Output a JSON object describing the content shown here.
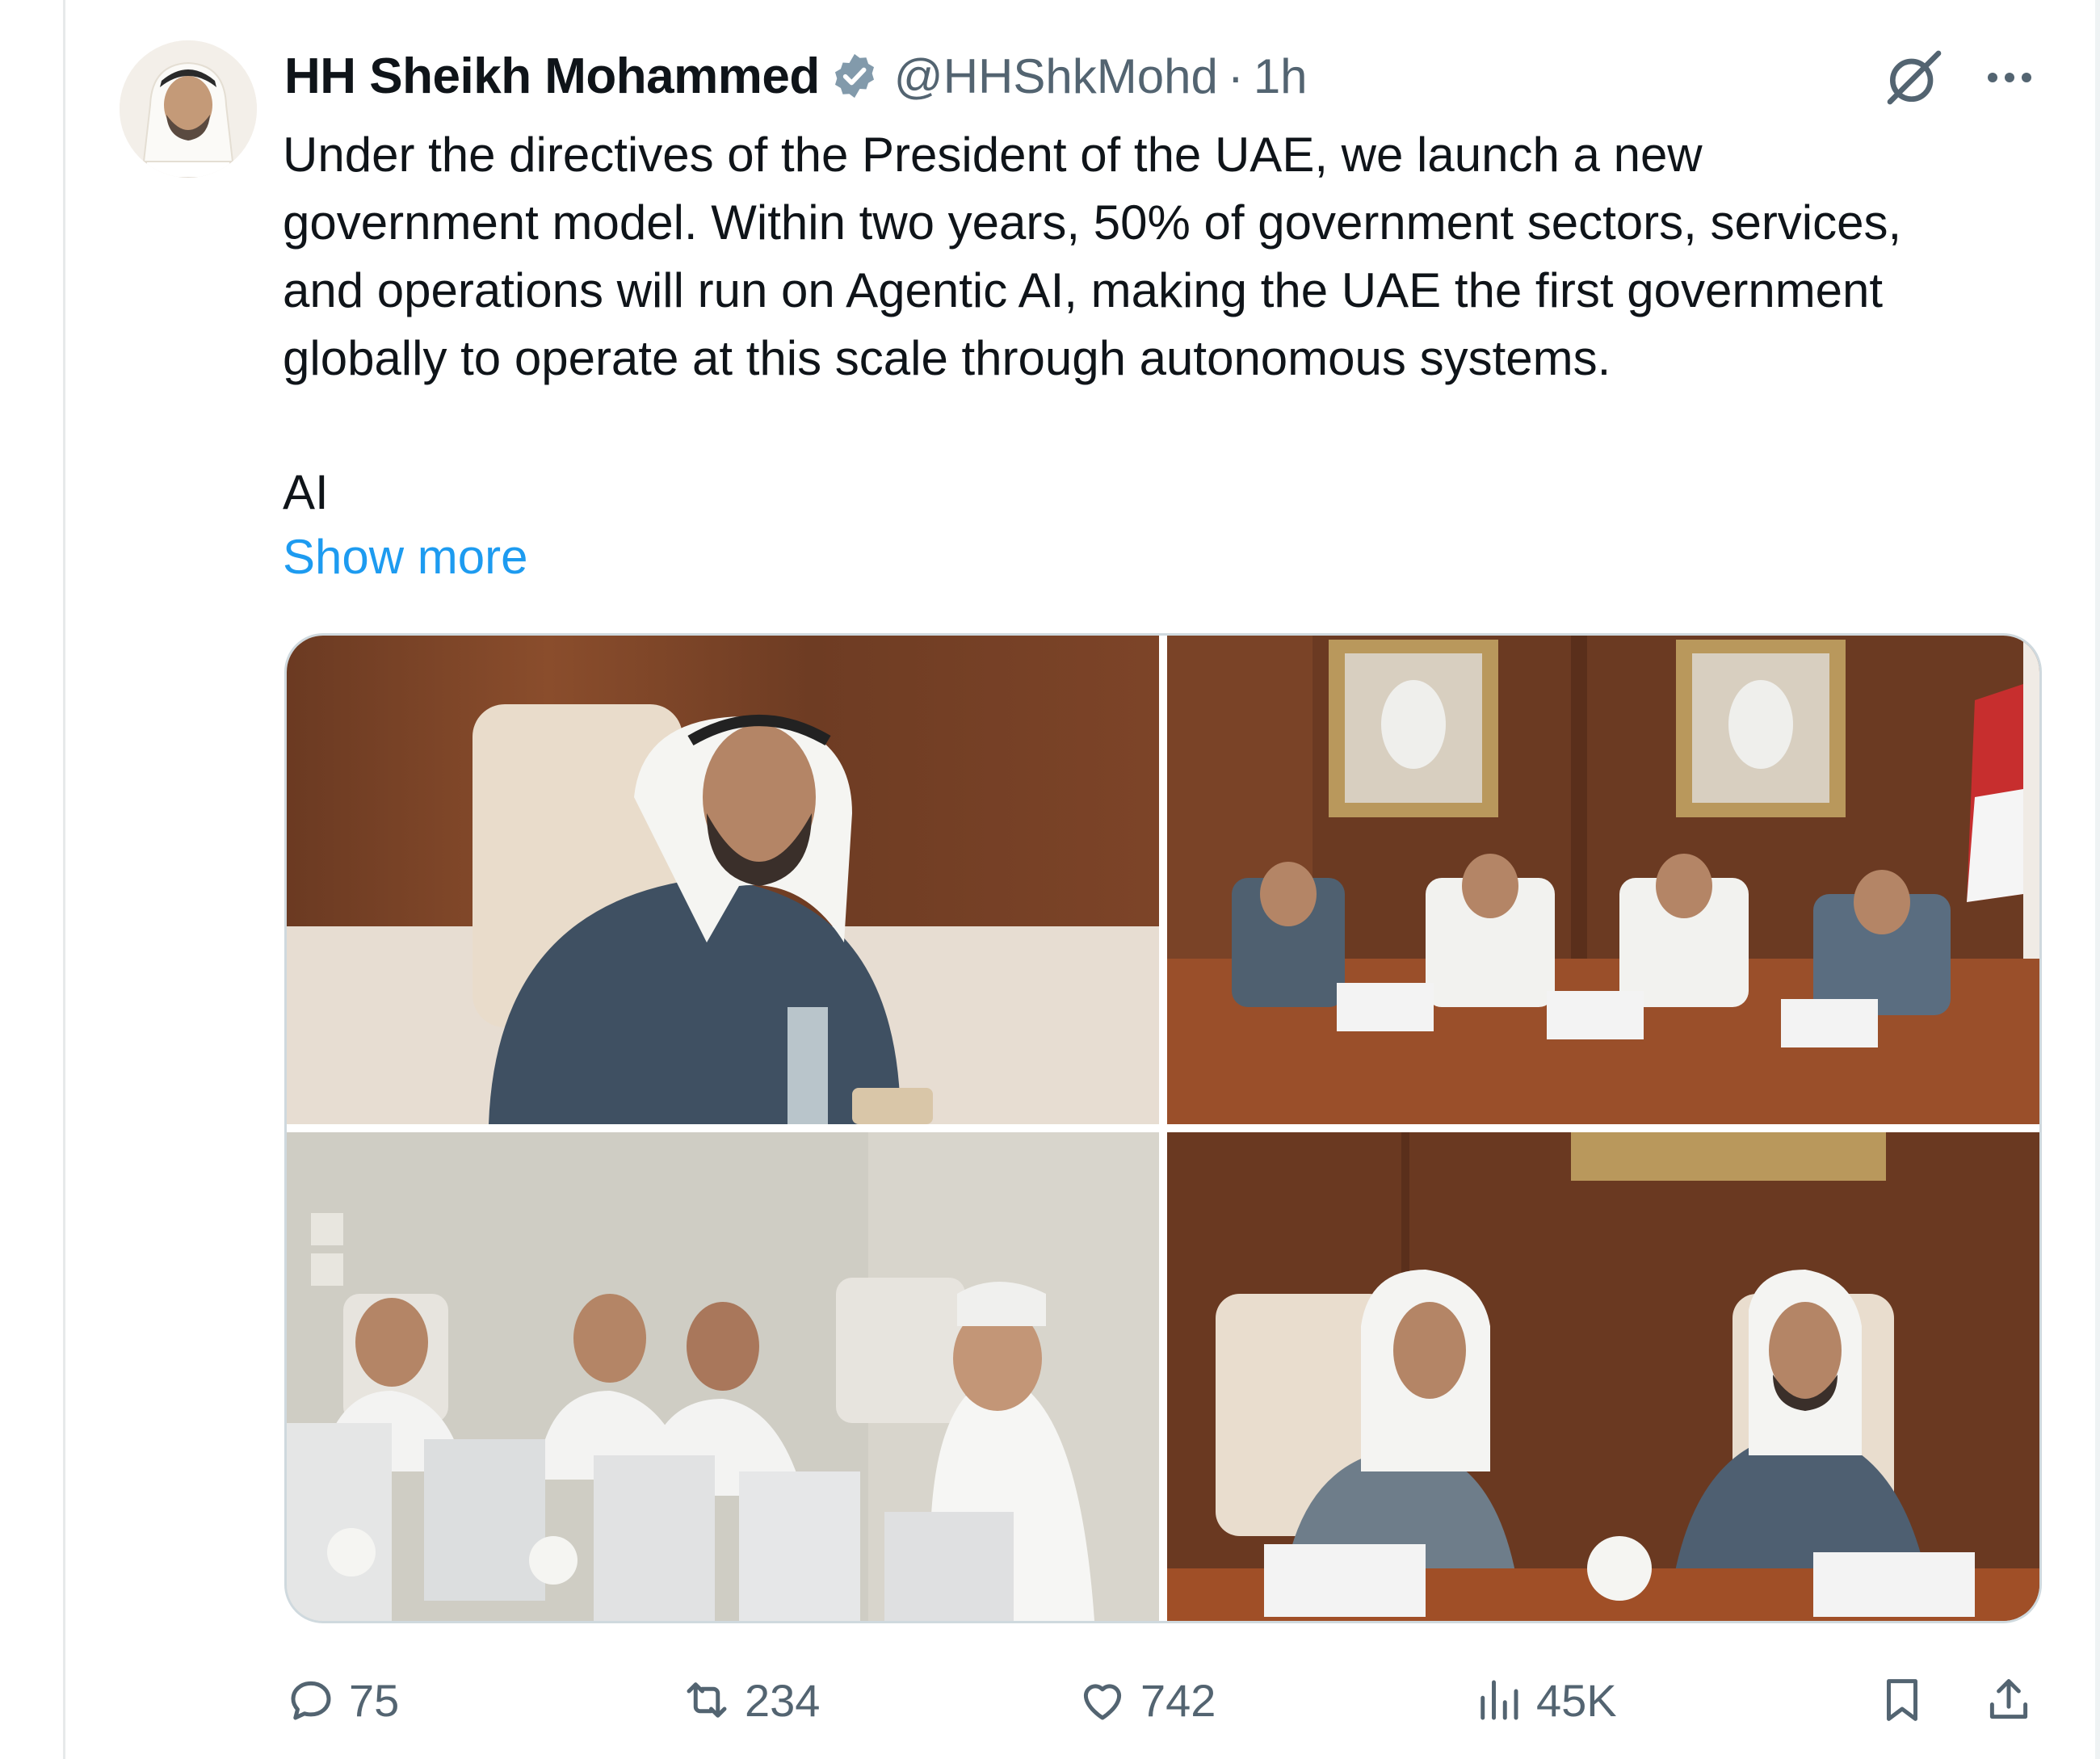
{
  "post": {
    "author": {
      "display_name": "HH Sheikh Mohammed",
      "handle": "@HHShkMohd",
      "verified_icon": "verified-badge-icon"
    },
    "separator": "·",
    "timestamp": "1h",
    "text": "Under the directives of the President of the UAE, we launch a new\ngovernment model. Within two years, 50% of government sectors, services,\nand operations will run on Agentic AI, making the UAE the first government\nglobally to operate at this scale through autonomous systems.",
    "text_continued": "AI",
    "show_more_label": "Show more",
    "media": {
      "photo_count": 4
    },
    "actions": {
      "replies": "75",
      "reposts": "234",
      "likes": "742",
      "views": "45K"
    }
  },
  "colors": {
    "text_primary": "#0f1419",
    "text_secondary": "#536471",
    "link": "#1d9bf0",
    "border": "#cfd9de"
  }
}
